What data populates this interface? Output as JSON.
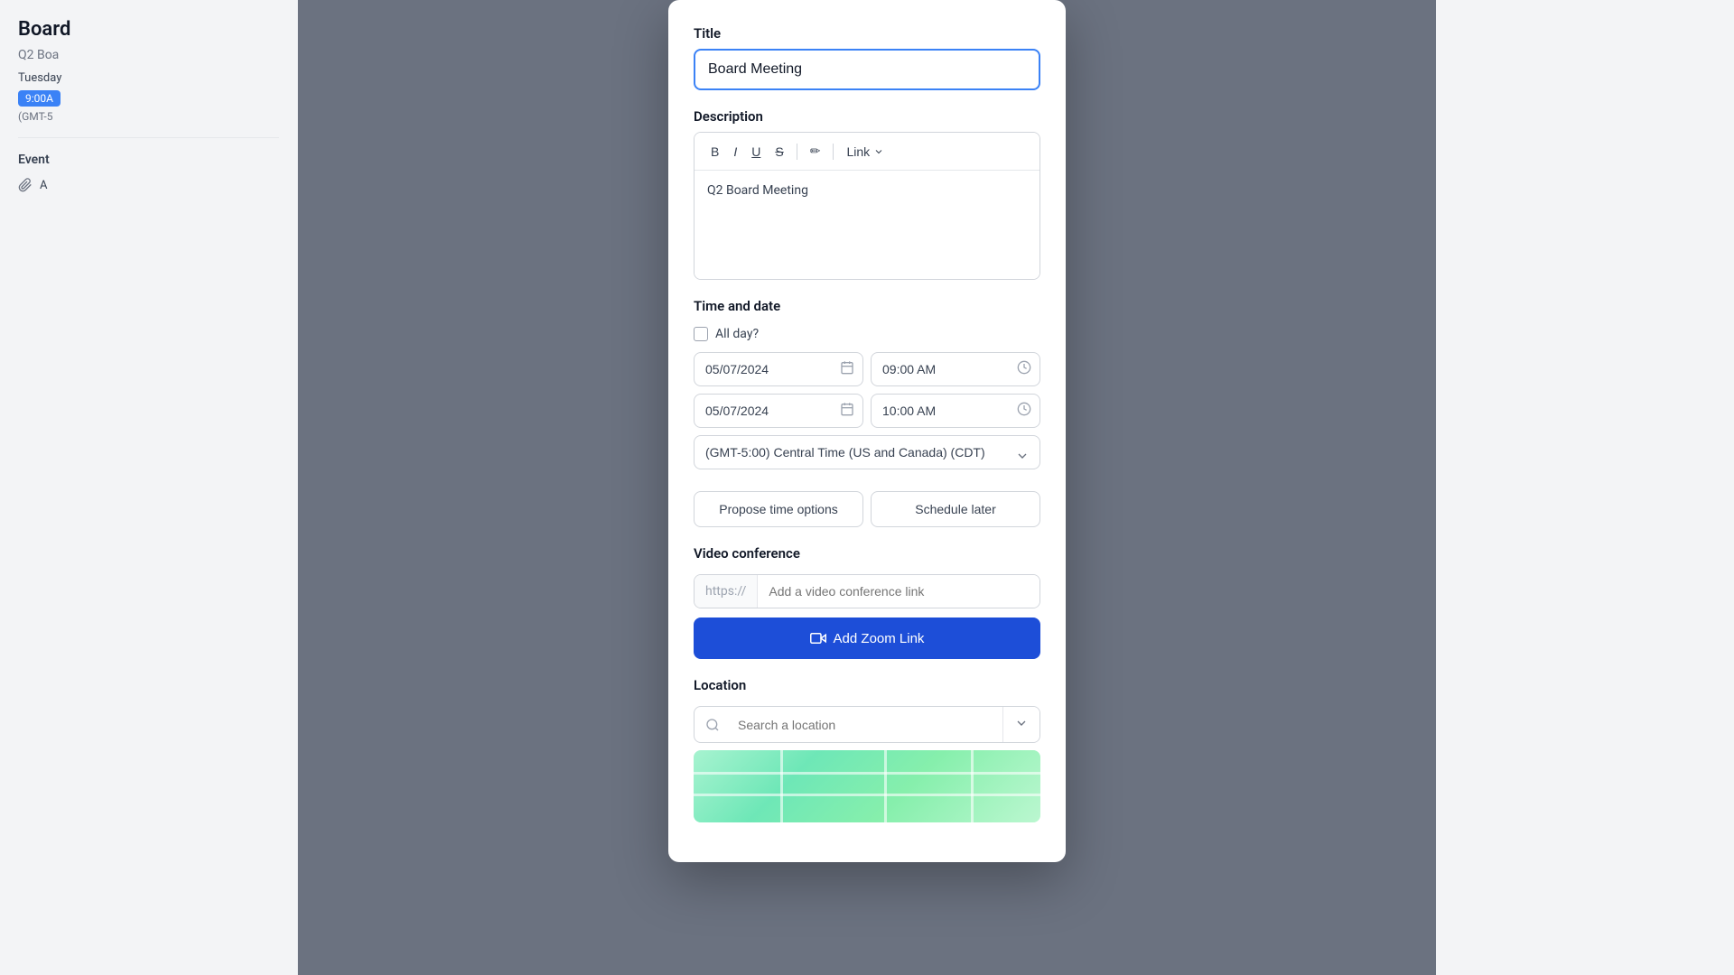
{
  "sidebar": {
    "event_title": "Board",
    "event_desc": "Q2 Boa",
    "event_day": "Tuesday",
    "event_time": "9:00A",
    "event_timezone": "(GMT-5",
    "section_title": "Event",
    "sidebar_item": "A"
  },
  "form": {
    "title_label": "Title",
    "title_value": "Board Meeting",
    "title_placeholder": "Board Meeting",
    "description_label": "Description",
    "description_content": "Q2 Board Meeting",
    "toolbar": {
      "bold": "B",
      "italic": "I",
      "underline": "U",
      "strikethrough": "S",
      "link_label": "Link",
      "highlight_icon": "✏"
    },
    "time_date_label": "Time and date",
    "all_day_label": "All day?",
    "start_date": "05/07/2024",
    "start_time": "09:00 AM",
    "end_date": "05/07/2024",
    "end_time": "10:00 AM",
    "timezone": "(GMT-5:00) Central Time (US and Canada) (CDT)",
    "propose_btn": "Propose time options",
    "schedule_btn": "Schedule later",
    "video_label": "Video conference",
    "https_prefix": "https://",
    "video_placeholder": "Add a video conference link",
    "zoom_btn": "Add Zoom Link",
    "location_label": "Location",
    "location_placeholder": "Search a location"
  },
  "colors": {
    "primary": "#1d4ed8",
    "border_active": "#3b82f6",
    "time_badge": "#3b82f6"
  }
}
